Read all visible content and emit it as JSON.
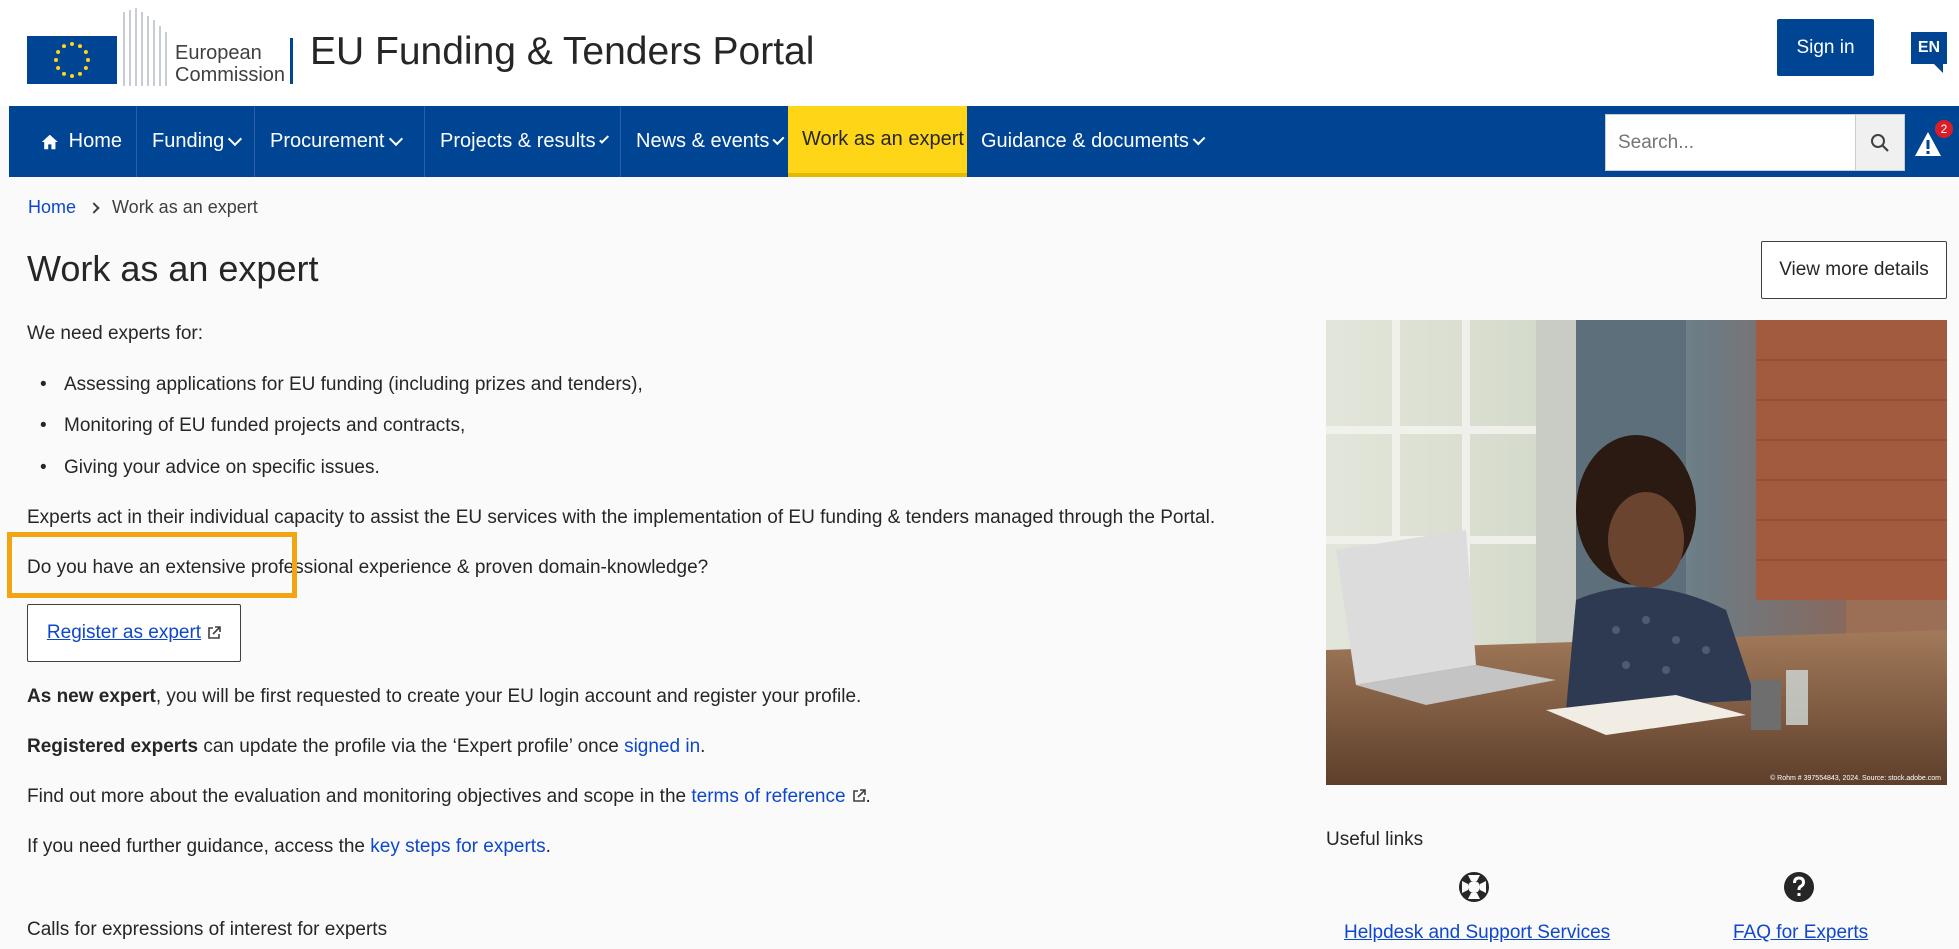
{
  "header": {
    "logo_line1": "European",
    "logo_line2": "Commission",
    "portal_title": "EU Funding & Tenders Portal",
    "signin_label": "Sign in",
    "language": "EN"
  },
  "nav": {
    "items": [
      {
        "label": "Home"
      },
      {
        "label": "Funding"
      },
      {
        "label": "Procurement"
      },
      {
        "label": "Projects & results"
      },
      {
        "label": "News & events"
      },
      {
        "label": "Work as an expert"
      },
      {
        "label": "Guidance & documents"
      }
    ],
    "search_placeholder": "Search...",
    "alert_count": "2"
  },
  "breadcrumb": {
    "home": "Home",
    "current": "Work as an expert"
  },
  "page": {
    "title": "Work as an expert",
    "view_more_label": "View more details",
    "intro": "We need experts for:",
    "bullets": [
      "Assessing applications for EU funding (including prizes and tenders),",
      "Monitoring of EU funded projects and contracts,",
      "Giving your advice on specific issues."
    ],
    "capacity_text": "Experts act in their individual capacity to assist the EU services with the implementation of EU funding & tenders managed through the Portal.",
    "question": "Do you have an extensive professional experience & proven domain-knowledge?",
    "register_label": "Register as expert",
    "new_expert_bold": "As new expert",
    "new_expert_rest": ", you will be first requested to create your EU login account and register your profile.",
    "registered_bold": "Registered experts",
    "registered_rest": " can update the profile via the ‘Expert profile’ once ",
    "signed_in_link": "signed in",
    "period": ".",
    "find_out_text": "Find out more about the evaluation and monitoring objectives and scope in the ",
    "terms_link": "terms of reference",
    "guidance_text": "If you need further guidance, access the ",
    "key_steps_link": "key steps for experts",
    "calls_heading": "Calls for expressions of interest for experts"
  },
  "photo": {
    "credit": "© Rohm # 397554843, 2024. Source: stock.adobe.com"
  },
  "useful_links": {
    "title": "Useful links",
    "items": [
      {
        "label": "Helpdesk and Support Services",
        "icon": "lifebuoy-icon"
      },
      {
        "label": "FAQ for Experts",
        "icon": "question-icon"
      }
    ]
  },
  "colors": {
    "primary": "#004494",
    "active_nav": "#ffd617",
    "link": "#0e47cb",
    "highlight": "#f2a413"
  }
}
